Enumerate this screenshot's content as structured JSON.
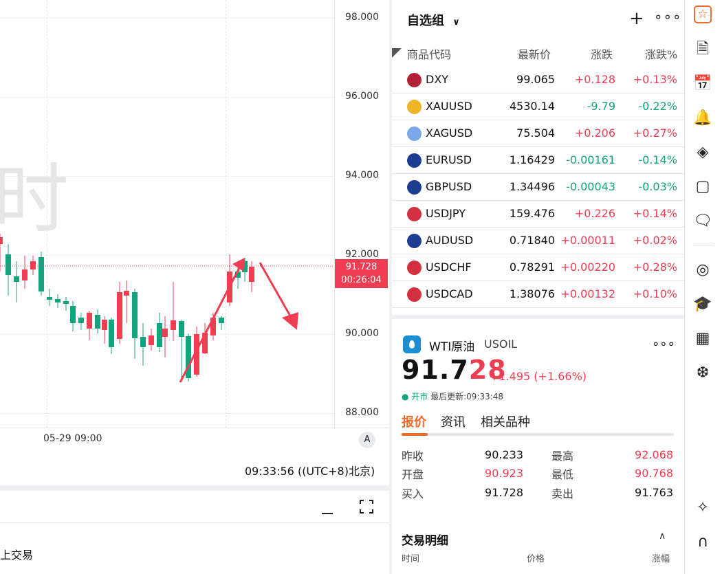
{
  "chart": {
    "price_axis": [
      "98.000",
      "96.000",
      "94.000",
      "92.000",
      "90.000",
      "88.000"
    ],
    "current_price": "91.728",
    "countdown": "00:26:04",
    "time_label": "05-29 09:00",
    "axis_btn": "A",
    "clock": "09:33:56 ((UTC+8)北京)",
    "watermark": "时",
    "lower_pane_text": "上交易"
  },
  "watchlist": {
    "title": "自选组",
    "headers": {
      "code": "商品代码",
      "price": "最新价",
      "change": "涨跌",
      "pct": "涨跌%"
    },
    "rows": [
      {
        "sym": "DXY",
        "price": "99.065",
        "chg": "+0.128",
        "pct": "+0.13%",
        "dir": "up",
        "flag": "#b22234"
      },
      {
        "sym": "XAUUSD",
        "price": "4530.14",
        "chg": "-9.79",
        "pct": "-0.22%",
        "dir": "dn",
        "flag": "#f0b429"
      },
      {
        "sym": "XAGUSD",
        "price": "75.504",
        "chg": "+0.206",
        "pct": "+0.27%",
        "dir": "up",
        "flag": "#7aa7e8"
      },
      {
        "sym": "EURUSD",
        "price": "1.16429",
        "chg": "-0.00161",
        "pct": "-0.14%",
        "dir": "dn",
        "flag": "#1d3b8f"
      },
      {
        "sym": "GBPUSD",
        "price": "1.34496",
        "chg": "-0.00043",
        "pct": "-0.03%",
        "dir": "dn",
        "flag": "#1d3b8f"
      },
      {
        "sym": "USDJPY",
        "price": "159.476",
        "chg": "+0.226",
        "pct": "+0.14%",
        "dir": "up",
        "flag": "#d32f3f"
      },
      {
        "sym": "AUDUSD",
        "price": "0.71840",
        "chg": "+0.00011",
        "pct": "+0.02%",
        "dir": "up",
        "flag": "#1d3b8f"
      },
      {
        "sym": "USDCHF",
        "price": "0.78291",
        "chg": "+0.00220",
        "pct": "+0.28%",
        "dir": "up",
        "flag": "#d32f3f"
      },
      {
        "sym": "USDCAD",
        "price": "1.38076",
        "chg": "+0.00132",
        "pct": "+0.10%",
        "dir": "up",
        "flag": "#d32f3f"
      }
    ]
  },
  "detail": {
    "name": "WTI原油",
    "code": "USOIL",
    "price_main": "91.7",
    "price_tail": "28",
    "change": "+1.495 (+1.66%)",
    "status": "● 开市",
    "updated": "最后更新:09:33:48",
    "tabs": [
      "报价",
      "资讯",
      "相关品种"
    ],
    "quotes": {
      "prev_close_label": "昨收",
      "prev_close": "90.233",
      "high_label": "最高",
      "high": "92.068",
      "open_label": "开盘",
      "open": "90.923",
      "low_label": "最低",
      "low": "90.768",
      "bid_label": "买入",
      "bid": "91.728",
      "ask_label": "卖出",
      "ask": "91.763"
    },
    "trade_title": "交易明细",
    "trade_cols": [
      "时间",
      "价格",
      "涨幅"
    ]
  },
  "colors": {
    "up": "#ef3d52",
    "down": "#14a37f",
    "accent": "#f06a2a"
  }
}
